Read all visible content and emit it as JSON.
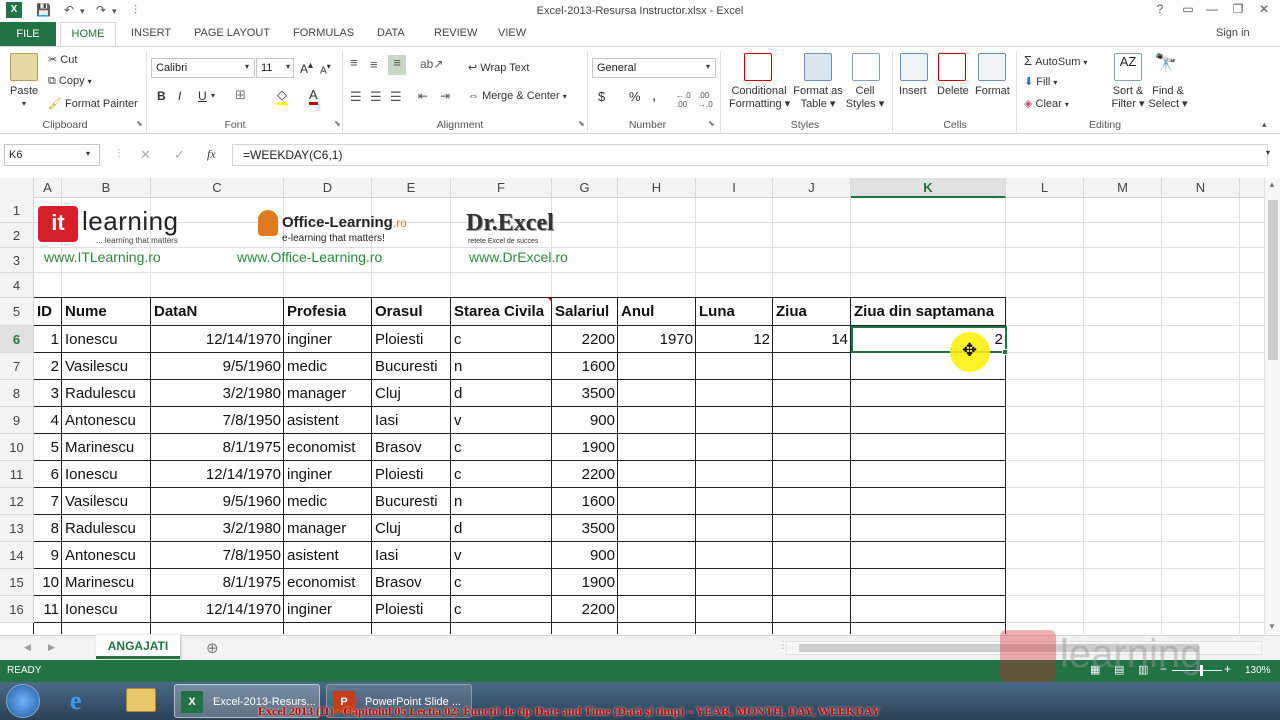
{
  "window": {
    "title": "Excel-2013-Resursa Instructor.xlsx - Excel",
    "help": "?",
    "minimize": "—",
    "restore": "❐",
    "close": "✕"
  },
  "tabs": {
    "file": "FILE",
    "home": "HOME",
    "insert": "INSERT",
    "page_layout": "PAGE LAYOUT",
    "formulas": "FORMULAS",
    "data": "DATA",
    "review": "REVIEW",
    "view": "VIEW",
    "signin": "Sign in"
  },
  "ribbon": {
    "clipboard": {
      "paste": "Paste",
      "cut": "Cut",
      "copy": "Copy",
      "format_painter": "Format Painter",
      "label": "Clipboard"
    },
    "font": {
      "name": "Calibri",
      "size": "11",
      "bold": "B",
      "italic": "I",
      "underline": "U",
      "label": "Font"
    },
    "alignment": {
      "wrap": "Wrap Text",
      "merge": "Merge & Center",
      "label": "Alignment"
    },
    "number": {
      "format": "General",
      "currency": "$",
      "percent": "%",
      "comma": ",",
      "label": "Number"
    },
    "styles": {
      "conditional": "Conditional",
      "formatting": "Formatting",
      "format_as": "Format as",
      "table": "Table",
      "cell": "Cell",
      "cell_styles": "Styles",
      "label": "Styles"
    },
    "cells": {
      "insert": "Insert",
      "delete": "Delete",
      "format": "Format",
      "label": "Cells"
    },
    "editing": {
      "autosum": "AutoSum",
      "fill": "Fill",
      "clear": "Clear",
      "sort": "Sort &",
      "filter": "Filter",
      "find": "Find &",
      "select": "Select",
      "label": "Editing"
    }
  },
  "formula_bar": {
    "name_box": "K6",
    "fx": "fx",
    "formula": "=WEEKDAY(C6,1)"
  },
  "columns": [
    "A",
    "B",
    "C",
    "D",
    "E",
    "F",
    "G",
    "H",
    "I",
    "J",
    "K",
    "L",
    "M",
    "N"
  ],
  "logos": {
    "it_brand": "learning",
    "it_tag": "... learning that matters",
    "it_url": "www.ITLearning.ro",
    "ol_brand": "Office-Learning",
    "ol_suffix": ".ro",
    "ol_tag": "e-learning that matters!",
    "ol_url": "www.Office-Learning.ro",
    "dr_brand": "Dr.Excel",
    "dr_tag": "retete Excel de succes",
    "dr_url": "www.DrExcel.ro"
  },
  "headers": [
    "ID",
    "Nume",
    "DataN",
    "Profesia",
    "Orasul",
    "Starea Civila",
    "Salariul",
    "Anul",
    "Luna",
    "Ziua",
    "Ziua din saptamana"
  ],
  "rows": [
    {
      "n": "6",
      "id": "1",
      "nume": "Ionescu",
      "data": "12/14/1970",
      "prof": "inginer",
      "oras": "Ploiesti",
      "stare": "c",
      "sal": "2200",
      "anul": "1970",
      "luna": "12",
      "ziua": "14",
      "zs": "2"
    },
    {
      "n": "7",
      "id": "2",
      "nume": "Vasilescu",
      "data": "9/5/1960",
      "prof": "medic",
      "oras": "Bucuresti",
      "stare": "n",
      "sal": "1600"
    },
    {
      "n": "8",
      "id": "3",
      "nume": "Radulescu",
      "data": "3/2/1980",
      "prof": "manager",
      "oras": "Cluj",
      "stare": "d",
      "sal": "3500"
    },
    {
      "n": "9",
      "id": "4",
      "nume": "Antonescu",
      "data": "7/8/1950",
      "prof": "asistent",
      "oras": "Iasi",
      "stare": "v",
      "sal": "900"
    },
    {
      "n": "10",
      "id": "5",
      "nume": "Marinescu",
      "data": "8/1/1975",
      "prof": "economist",
      "oras": "Brasov",
      "stare": "c",
      "sal": "1900"
    },
    {
      "n": "11",
      "id": "6",
      "nume": "Ionescu",
      "data": "12/14/1970",
      "prof": "inginer",
      "oras": "Ploiesti",
      "stare": "c",
      "sal": "2200"
    },
    {
      "n": "12",
      "id": "7",
      "nume": "Vasilescu",
      "data": "9/5/1960",
      "prof": "medic",
      "oras": "Bucuresti",
      "stare": "n",
      "sal": "1600"
    },
    {
      "n": "13",
      "id": "8",
      "nume": "Radulescu",
      "data": "3/2/1980",
      "prof": "manager",
      "oras": "Cluj",
      "stare": "d",
      "sal": "3500"
    },
    {
      "n": "14",
      "id": "9",
      "nume": "Antonescu",
      "data": "7/8/1950",
      "prof": "asistent",
      "oras": "Iasi",
      "stare": "v",
      "sal": "900"
    },
    {
      "n": "15",
      "id": "10",
      "nume": "Marinescu",
      "data": "8/1/1975",
      "prof": "economist",
      "oras": "Brasov",
      "stare": "c",
      "sal": "1900"
    },
    {
      "n": "16",
      "id": "11",
      "nume": "Ionescu",
      "data": "12/14/1970",
      "prof": "inginer",
      "oras": "Ploiesti",
      "stare": "c",
      "sal": "2200"
    }
  ],
  "row_numbers": [
    "1",
    "2",
    "3",
    "4",
    "5"
  ],
  "sheet": {
    "name": "ANGAJATI",
    "add": "⊕"
  },
  "status": {
    "ready": "READY",
    "zoom": "130%"
  },
  "taskbar": {
    "excel": "Excel-2013-Resurs...",
    "ppt": "PowerPoint Slide ..."
  },
  "caption": "Excel 2013 (II) - Capitolul 05 Lectia 02: Funcții de tip Date and Time (Dată și timp) – YEAR, MONTH, DAY, WEEKDAY",
  "colors": {
    "excel_green": "#217346",
    "accent_red": "#c00000",
    "highlight": "#ffef00"
  }
}
